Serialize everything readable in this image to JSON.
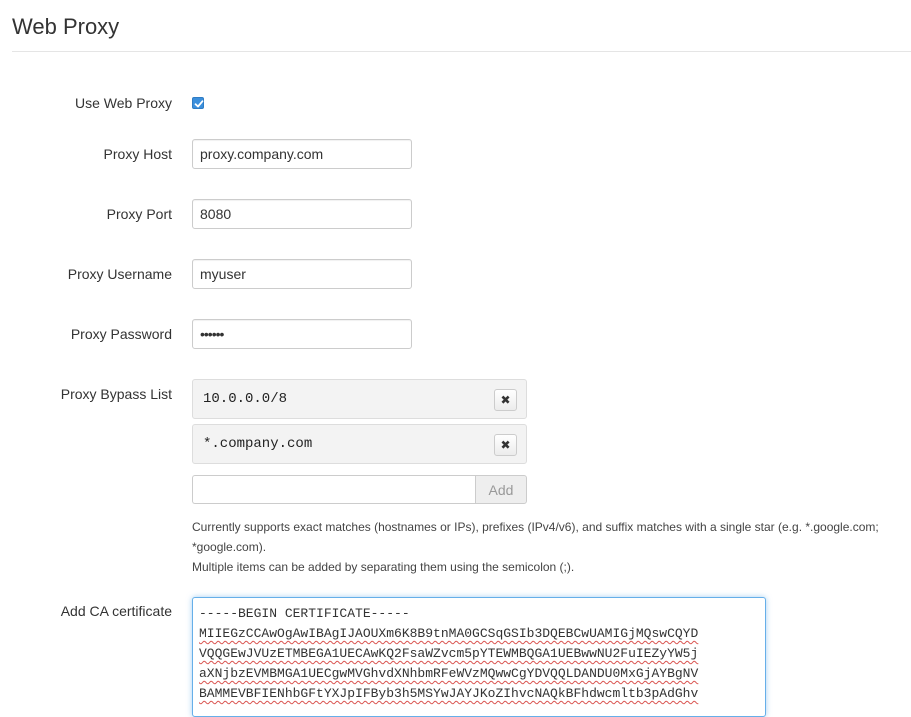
{
  "page": {
    "title": "Web Proxy"
  },
  "use_proxy": {
    "label": "Use Web Proxy",
    "checked": true
  },
  "host": {
    "label": "Proxy Host",
    "value": "proxy.company.com"
  },
  "port": {
    "label": "Proxy Port",
    "value": "8080"
  },
  "username": {
    "label": "Proxy Username",
    "value": "myuser"
  },
  "password": {
    "label": "Proxy Password",
    "value": "••••••"
  },
  "bypass": {
    "label": "Proxy Bypass List",
    "items": [
      {
        "value": "10.0.0.0/8",
        "remove_label": "✖"
      },
      {
        "value": "*.company.com",
        "remove_label": "✖"
      }
    ],
    "new_value": "",
    "add_label": "Add",
    "help_1": "Currently supports exact matches (hostnames or IPs), prefixes (IPv4/v6), and suffix matches with a single star (e.g. *.google.com; *google.com).",
    "help_2": "Multiple items can be added by separating them using the semicolon (;)."
  },
  "ca_cert": {
    "label": "Add CA certificate",
    "lines": [
      "-----BEGIN CERTIFICATE-----",
      "MIIEGzCCAwOgAwIBAgIJAOUXm6K8B9tnMA0GCSqGSIb3DQEBCwUAMIGjMQswCQYD",
      "VQQGEwJVUzETMBEGA1UECAwKQ2FsaWZvcm5pYTEWMBQGA1UEBwwNU2FuIEZyYW5j",
      "aXNjbzEVMBMGA1UECgwMVGhvdXNhbmRFeWVzMQwwCgYDVQQLDANDU0MxGjAYBgNV",
      "BAMMEVBFIENhbGFtYXJpIFByb3h5MSYwJAYJKoZIhvcNAQkBFhdwcmltb3pAdGhv"
    ]
  }
}
